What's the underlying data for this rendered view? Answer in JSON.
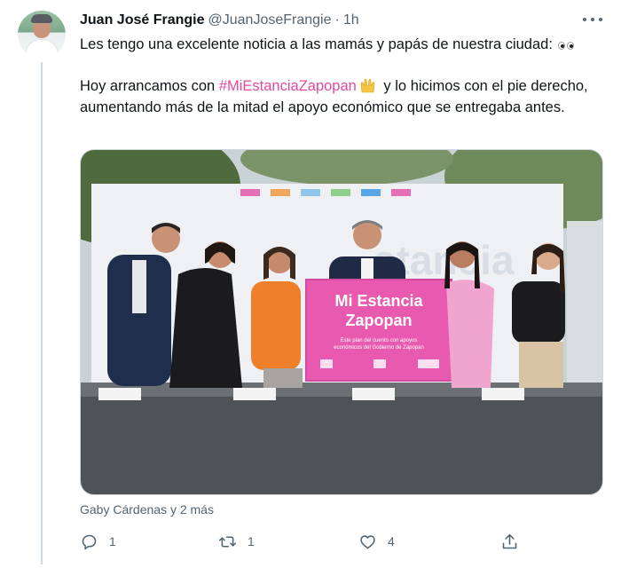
{
  "tweet": {
    "author_name": "Juan José Frangie",
    "author_handle": "@JuanJoseFrangie",
    "separator": "·",
    "time": "1h",
    "text_line1": "Les tengo una excelente noticia a las mamás y papás de nuestra ciudad:",
    "text_p2_before": "Hoy arrancamos con ",
    "hashtag": "#MiEstanciaZapopan",
    "text_p2_after": " y lo hicimos con el pie derecho, aumentando más de la mitad el apoyo económico que se entregaba antes.",
    "emoji_line1": "eyes-emoji",
    "emoji_line2": "raising-hands-emoji"
  },
  "photo": {
    "banner_title_line1": "Mi Estancia",
    "banner_title_line2": "Zapopan",
    "banner_subtitle_line1": "Este plan del cuento con apoyos",
    "banner_subtitle_line2": "económicos del Gobierno de Zapopan"
  },
  "tagged": "Gaby Cárdenas y 2 más",
  "actions": {
    "reply_count": "1",
    "retweet_count": "1",
    "like_count": "4"
  },
  "colors": {
    "hashtag": "#e24a9d",
    "secondary_text": "#536471",
    "banner_pink": "#e85ab0"
  },
  "icons": [
    "more-icon",
    "reply-icon",
    "retweet-icon",
    "like-icon",
    "share-icon"
  ]
}
